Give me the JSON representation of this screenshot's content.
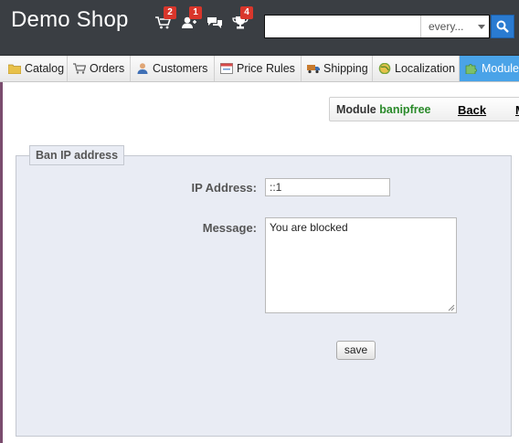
{
  "header": {
    "shop_name": "Demo Shop",
    "notifications": [
      {
        "icon": "cart-icon",
        "count": "2"
      },
      {
        "icon": "customers-icon",
        "count": "1"
      },
      {
        "icon": "messages-icon",
        "count": ""
      },
      {
        "icon": "trophy-icon",
        "count": "4"
      }
    ],
    "search": {
      "value": "",
      "placeholder": "",
      "scope": "every..."
    }
  },
  "tabs": [
    {
      "label": "Catalog",
      "icon": "folder-icon"
    },
    {
      "label": "Orders",
      "icon": "cart-icon"
    },
    {
      "label": "Customers",
      "icon": "customer-icon"
    },
    {
      "label": "Price Rules",
      "icon": "price-rules-icon"
    },
    {
      "label": "Shipping",
      "icon": "truck-icon"
    },
    {
      "label": "Localization",
      "icon": "globe-icon"
    },
    {
      "label": "Modules",
      "icon": "puzzle-icon",
      "active": true
    }
  ],
  "toolbar": {
    "module_prefix": "Module",
    "module_name": "banipfree",
    "back_label": "Back",
    "more_label": "M"
  },
  "form": {
    "legend": "Ban IP address",
    "ip_label": "IP Address:",
    "ip_value": "::1",
    "message_label": "Message:",
    "message_value": "You are blocked",
    "save_label": "save"
  },
  "colors": {
    "header_bg": "#3a3e43",
    "active_tab": "#4aa3e8",
    "module_name": "#2a8a2a",
    "badge": "#d9362b",
    "panel_bg": "#e9ecf4"
  }
}
